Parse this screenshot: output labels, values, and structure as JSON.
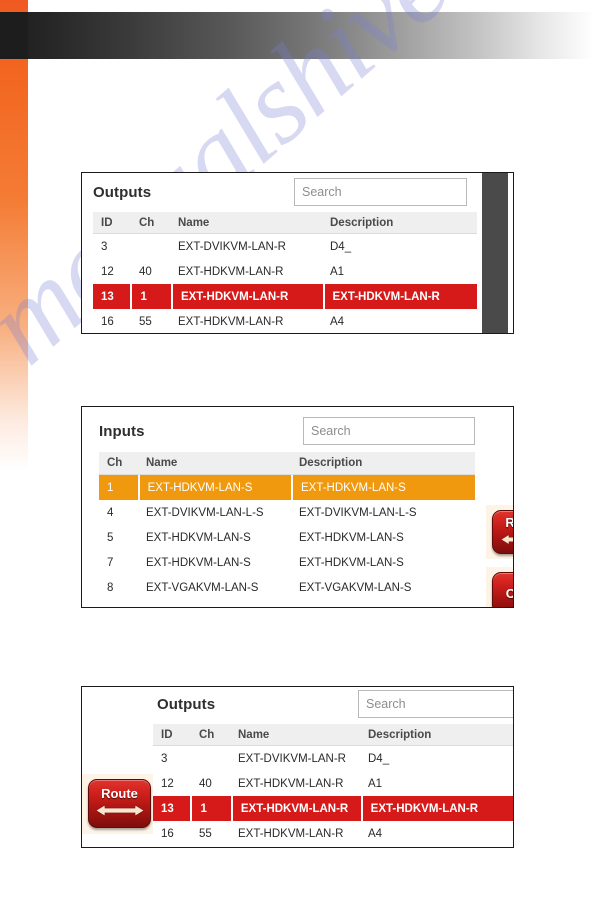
{
  "document": {
    "watermark": "manualshive.com",
    "orange_accent": "#f05a22",
    "selected_red": "#d51a19",
    "selected_orange": "#f0990e"
  },
  "panels": [
    {
      "id": "outputs-top",
      "title": "Outputs",
      "search": {
        "placeholder": "Search",
        "value": ""
      },
      "columns": [
        "ID",
        "Ch",
        "Name",
        "Description"
      ],
      "rows": [
        {
          "id": "3",
          "ch": "",
          "name": "EXT-DVIKVM-LAN-R",
          "description": "D4_",
          "state": "normal"
        },
        {
          "id": "12",
          "ch": "40",
          "name": "EXT-HDKVM-LAN-R",
          "description": "A1",
          "state": "normal"
        },
        {
          "id": "13",
          "ch": "1",
          "name": "EXT-HDKVM-LAN-R",
          "description": "EXT-HDKVM-LAN-R",
          "state": "selected-red"
        },
        {
          "id": "16",
          "ch": "55",
          "name": "EXT-HDKVM-LAN-R",
          "description": "A4",
          "state": "normal"
        }
      ],
      "scrollbar": true
    },
    {
      "id": "inputs",
      "title": "Inputs",
      "search": {
        "placeholder": "Search",
        "value": ""
      },
      "columns": [
        "Ch",
        "Name",
        "Description"
      ],
      "rows": [
        {
          "ch": "1",
          "name": "EXT-HDKVM-LAN-S",
          "description": "EXT-HDKVM-LAN-S",
          "state": "selected-orange"
        },
        {
          "ch": "4",
          "name": "EXT-DVIKVM-LAN-L-S",
          "description": "EXT-DVIKVM-LAN-L-S",
          "state": "normal"
        },
        {
          "ch": "5",
          "name": "EXT-HDKVM-LAN-S",
          "description": "EXT-HDKVM-LAN-S",
          "state": "normal"
        },
        {
          "ch": "7",
          "name": "EXT-HDKVM-LAN-S",
          "description": "EXT-HDKVM-LAN-S",
          "state": "normal"
        },
        {
          "ch": "8",
          "name": "EXT-VGAKVM-LAN-S",
          "description": "EXT-VGAKVM-LAN-S",
          "state": "normal"
        }
      ],
      "side_buttons": [
        {
          "label": "Ro",
          "full_label": "Route",
          "arrow": "←"
        },
        {
          "label": "Ca",
          "full_label": "Cancel",
          "arrow": ""
        }
      ]
    },
    {
      "id": "outputs-bottom",
      "title": "Outputs",
      "search": {
        "placeholder": "Search",
        "value": ""
      },
      "columns": [
        "ID",
        "Ch",
        "Name",
        "Description"
      ],
      "rows": [
        {
          "id": "3",
          "ch": "",
          "name": "EXT-DVIKVM-LAN-R",
          "description": "D4_",
          "state": "normal"
        },
        {
          "id": "12",
          "ch": "40",
          "name": "EXT-HDKVM-LAN-R",
          "description": "A1",
          "state": "normal"
        },
        {
          "id": "13",
          "ch": "1",
          "name": "EXT-HDKVM-LAN-R",
          "description": "EXT-HDKVM-LAN-R",
          "state": "selected-red"
        },
        {
          "id": "16",
          "ch": "55",
          "name": "EXT-HDKVM-LAN-R",
          "description": "A4",
          "state": "normal"
        }
      ],
      "route_button": {
        "label": "Route",
        "arrow": "⟷"
      }
    }
  ]
}
